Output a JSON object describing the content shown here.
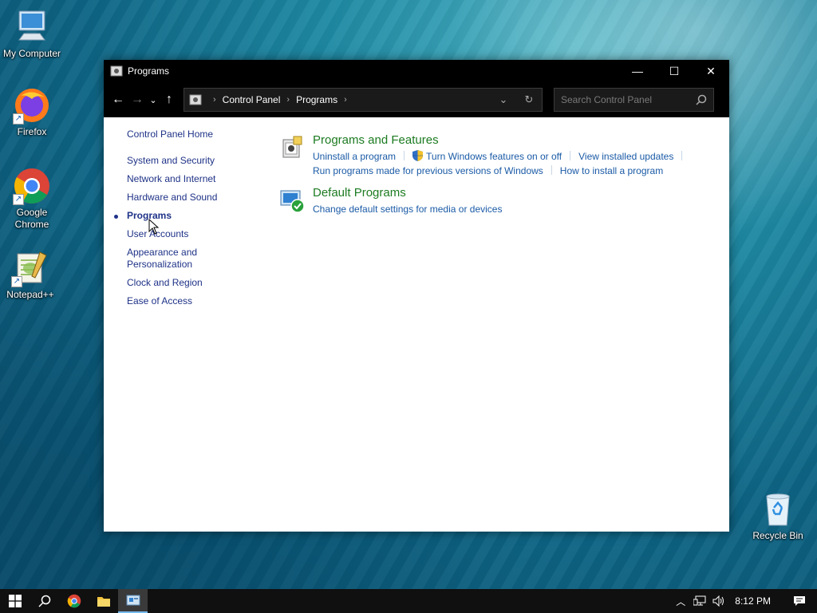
{
  "desktop": {
    "icons": [
      {
        "label": "My Computer"
      },
      {
        "label": "Firefox"
      },
      {
        "label": "Google Chrome"
      },
      {
        "label": "Notepad++"
      },
      {
        "label": "Recycle Bin"
      }
    ]
  },
  "window": {
    "title": "Programs",
    "controls": {
      "minimize": "—",
      "maximize": "☐",
      "close": "✕"
    },
    "address": {
      "crumbs": [
        "Control Panel",
        "Programs"
      ]
    },
    "search": {
      "placeholder": "Search Control Panel"
    }
  },
  "leftnav": {
    "home": "Control Panel Home",
    "items": [
      "System and Security",
      "Network and Internet",
      "Hardware and Sound",
      "Programs",
      "User Accounts",
      "Appearance and Personalization",
      "Clock and Region",
      "Ease of Access"
    ],
    "current_index": 3
  },
  "main": {
    "sections": [
      {
        "title": "Programs and Features",
        "icon": "programs-features-icon",
        "links": [
          "Uninstall a program",
          "Turn Windows features on or off",
          "View installed updates",
          "Run programs made for previous versions of Windows",
          "How to install a program"
        ]
      },
      {
        "title": "Default Programs",
        "icon": "default-programs-icon",
        "links": [
          "Change default settings for media or devices"
        ]
      }
    ]
  },
  "taskbar": {
    "clock": "8:12 PM"
  },
  "colors": {
    "link": "#1a5aa6",
    "section_title": "#1c7b21",
    "nav_link": "#1e3287",
    "chrome_bg": "#000000"
  }
}
